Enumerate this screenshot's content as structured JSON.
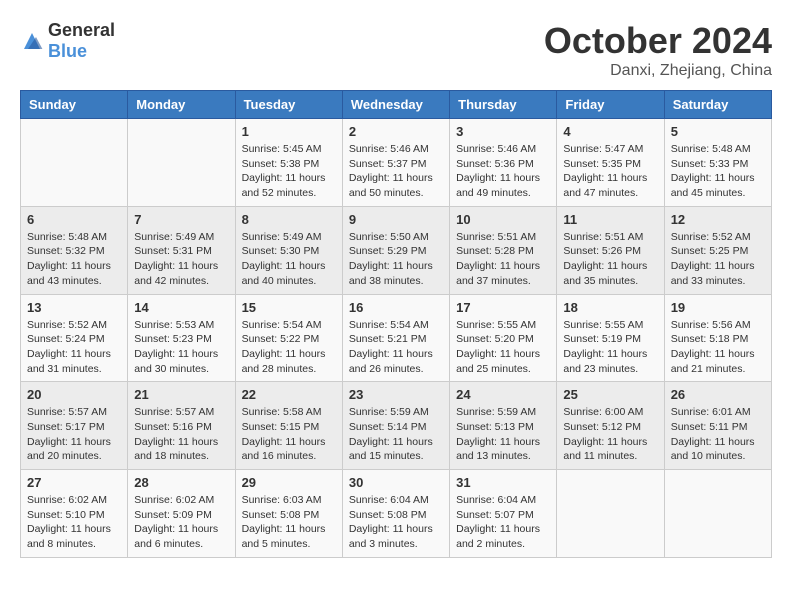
{
  "header": {
    "logo_general": "General",
    "logo_blue": "Blue",
    "month": "October 2024",
    "location": "Danxi, Zhejiang, China"
  },
  "days_of_week": [
    "Sunday",
    "Monday",
    "Tuesday",
    "Wednesday",
    "Thursday",
    "Friday",
    "Saturday"
  ],
  "weeks": [
    [
      {
        "day": "",
        "info": ""
      },
      {
        "day": "",
        "info": ""
      },
      {
        "day": "1",
        "info": "Sunrise: 5:45 AM\nSunset: 5:38 PM\nDaylight: 11 hours and 52 minutes."
      },
      {
        "day": "2",
        "info": "Sunrise: 5:46 AM\nSunset: 5:37 PM\nDaylight: 11 hours and 50 minutes."
      },
      {
        "day": "3",
        "info": "Sunrise: 5:46 AM\nSunset: 5:36 PM\nDaylight: 11 hours and 49 minutes."
      },
      {
        "day": "4",
        "info": "Sunrise: 5:47 AM\nSunset: 5:35 PM\nDaylight: 11 hours and 47 minutes."
      },
      {
        "day": "5",
        "info": "Sunrise: 5:48 AM\nSunset: 5:33 PM\nDaylight: 11 hours and 45 minutes."
      }
    ],
    [
      {
        "day": "6",
        "info": "Sunrise: 5:48 AM\nSunset: 5:32 PM\nDaylight: 11 hours and 43 minutes."
      },
      {
        "day": "7",
        "info": "Sunrise: 5:49 AM\nSunset: 5:31 PM\nDaylight: 11 hours and 42 minutes."
      },
      {
        "day": "8",
        "info": "Sunrise: 5:49 AM\nSunset: 5:30 PM\nDaylight: 11 hours and 40 minutes."
      },
      {
        "day": "9",
        "info": "Sunrise: 5:50 AM\nSunset: 5:29 PM\nDaylight: 11 hours and 38 minutes."
      },
      {
        "day": "10",
        "info": "Sunrise: 5:51 AM\nSunset: 5:28 PM\nDaylight: 11 hours and 37 minutes."
      },
      {
        "day": "11",
        "info": "Sunrise: 5:51 AM\nSunset: 5:26 PM\nDaylight: 11 hours and 35 minutes."
      },
      {
        "day": "12",
        "info": "Sunrise: 5:52 AM\nSunset: 5:25 PM\nDaylight: 11 hours and 33 minutes."
      }
    ],
    [
      {
        "day": "13",
        "info": "Sunrise: 5:52 AM\nSunset: 5:24 PM\nDaylight: 11 hours and 31 minutes."
      },
      {
        "day": "14",
        "info": "Sunrise: 5:53 AM\nSunset: 5:23 PM\nDaylight: 11 hours and 30 minutes."
      },
      {
        "day": "15",
        "info": "Sunrise: 5:54 AM\nSunset: 5:22 PM\nDaylight: 11 hours and 28 minutes."
      },
      {
        "day": "16",
        "info": "Sunrise: 5:54 AM\nSunset: 5:21 PM\nDaylight: 11 hours and 26 minutes."
      },
      {
        "day": "17",
        "info": "Sunrise: 5:55 AM\nSunset: 5:20 PM\nDaylight: 11 hours and 25 minutes."
      },
      {
        "day": "18",
        "info": "Sunrise: 5:55 AM\nSunset: 5:19 PM\nDaylight: 11 hours and 23 minutes."
      },
      {
        "day": "19",
        "info": "Sunrise: 5:56 AM\nSunset: 5:18 PM\nDaylight: 11 hours and 21 minutes."
      }
    ],
    [
      {
        "day": "20",
        "info": "Sunrise: 5:57 AM\nSunset: 5:17 PM\nDaylight: 11 hours and 20 minutes."
      },
      {
        "day": "21",
        "info": "Sunrise: 5:57 AM\nSunset: 5:16 PM\nDaylight: 11 hours and 18 minutes."
      },
      {
        "day": "22",
        "info": "Sunrise: 5:58 AM\nSunset: 5:15 PM\nDaylight: 11 hours and 16 minutes."
      },
      {
        "day": "23",
        "info": "Sunrise: 5:59 AM\nSunset: 5:14 PM\nDaylight: 11 hours and 15 minutes."
      },
      {
        "day": "24",
        "info": "Sunrise: 5:59 AM\nSunset: 5:13 PM\nDaylight: 11 hours and 13 minutes."
      },
      {
        "day": "25",
        "info": "Sunrise: 6:00 AM\nSunset: 5:12 PM\nDaylight: 11 hours and 11 minutes."
      },
      {
        "day": "26",
        "info": "Sunrise: 6:01 AM\nSunset: 5:11 PM\nDaylight: 11 hours and 10 minutes."
      }
    ],
    [
      {
        "day": "27",
        "info": "Sunrise: 6:02 AM\nSunset: 5:10 PM\nDaylight: 11 hours and 8 minutes."
      },
      {
        "day": "28",
        "info": "Sunrise: 6:02 AM\nSunset: 5:09 PM\nDaylight: 11 hours and 6 minutes."
      },
      {
        "day": "29",
        "info": "Sunrise: 6:03 AM\nSunset: 5:08 PM\nDaylight: 11 hours and 5 minutes."
      },
      {
        "day": "30",
        "info": "Sunrise: 6:04 AM\nSunset: 5:08 PM\nDaylight: 11 hours and 3 minutes."
      },
      {
        "day": "31",
        "info": "Sunrise: 6:04 AM\nSunset: 5:07 PM\nDaylight: 11 hours and 2 minutes."
      },
      {
        "day": "",
        "info": ""
      },
      {
        "day": "",
        "info": ""
      }
    ]
  ]
}
